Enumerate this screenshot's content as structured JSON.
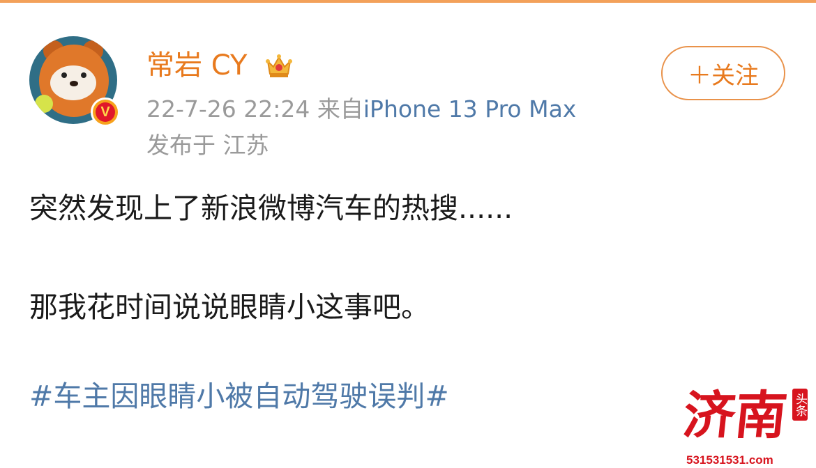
{
  "user": {
    "name": "常岩 CY",
    "verified_badge_letter": "V"
  },
  "meta": {
    "time": "22-7-26 22:24",
    "source_prefix": "来自",
    "device": "iPhone 13 Pro Max",
    "location": "发布于 江苏"
  },
  "follow_button": {
    "label": "＋关注"
  },
  "post": {
    "line1": "突然发现上了新浪微博汽车的热搜......",
    "line2": "那我花时间说说眼睛小这事吧。",
    "hashtag": "#车主因眼睛小被自动驾驶误判#"
  },
  "watermark": {
    "main": "济南",
    "stamp": "头条",
    "url": "531531531.com"
  },
  "colors": {
    "accent_orange": "#e87a1e",
    "link_blue": "#4f79a8",
    "meta_gray": "#9a9a9a",
    "watermark_red": "#d7141e"
  }
}
